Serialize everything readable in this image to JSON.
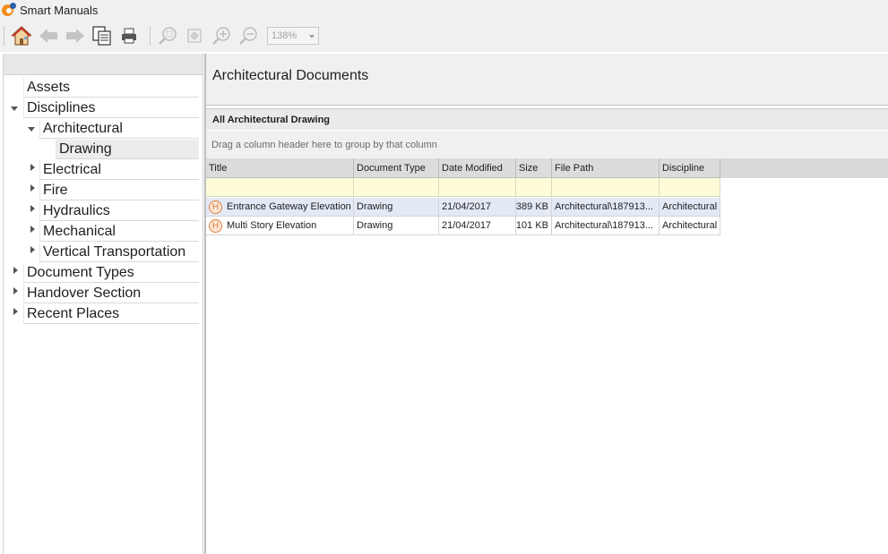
{
  "window": {
    "title": "Smart Manuals"
  },
  "toolbar": {
    "zoom_value": "138%",
    "buttons": [
      "home-icon",
      "back-arrow-icon",
      "forward-arrow-icon",
      "copy-document-icon",
      "print-icon",
      "zoom-region-icon",
      "fit-page-icon",
      "zoom-in-icon",
      "zoom-out-icon"
    ]
  },
  "tree": {
    "assets": "Assets",
    "disciplines": "Disciplines",
    "architectural": "Architectural",
    "drawing": "Drawing",
    "electrical": "Electrical",
    "fire": "Fire",
    "hydraulics": "Hydraulics",
    "mechanical": "Mechanical",
    "vertical_transportation": "Vertical Transportation",
    "document_types": "Document Types",
    "handover_section": "Handover Section",
    "recent_places": "Recent Places"
  },
  "main": {
    "page_title": "Architectural Documents",
    "grid_caption": "All Architectural Drawing",
    "group_hint": "Drag a column header here to group by that column",
    "columns": {
      "title": "Title",
      "document_type": "Document Type",
      "date_modified": "Date Modified",
      "size": "Size",
      "file_path": "File Path",
      "discipline": "Discipline"
    },
    "rows": [
      {
        "icon": "H",
        "title": "Entrance Gateway Elevation",
        "document_type": "Drawing",
        "date_modified": "21/04/2017",
        "size": "389 KB",
        "file_path": "Architectural\\187913...",
        "discipline": "Architectural"
      },
      {
        "icon": "H",
        "title": "Multi Story Elevation",
        "document_type": "Drawing",
        "date_modified": "21/04/2017",
        "size": "101 KB",
        "file_path": "Architectural\\187913...",
        "discipline": "Architectural"
      }
    ]
  }
}
